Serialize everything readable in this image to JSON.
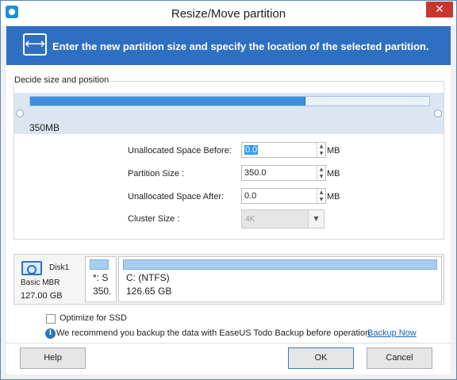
{
  "window": {
    "title": "Resize/Move partition",
    "close_glyph": "✕"
  },
  "banner": {
    "icon": "resize-arrows-icon",
    "text": "Enter the new partition size and specify the location of the selected partition."
  },
  "size_group": {
    "title": "Decide size and position",
    "size_label": "350MB",
    "fill_percent": 69
  },
  "fields": {
    "before": {
      "label": "Unallocated Space Before:",
      "value": "0.0",
      "unit": "MB"
    },
    "size": {
      "label": "Partition Size :",
      "value": "350.0",
      "unit": "MB"
    },
    "after": {
      "label": "Unallocated Space After:",
      "value": "0.0",
      "unit": "MB"
    },
    "cluster": {
      "label": "Cluster Size :",
      "value": "4K"
    }
  },
  "disk_map": {
    "disk_name": "Disk1",
    "disk_type": "Basic MBR",
    "disk_size": "127.00 GB",
    "partitions": [
      {
        "name": "*: S",
        "size": "350."
      },
      {
        "name": "C: (NTFS)",
        "size": "126.65 GB"
      }
    ]
  },
  "options": {
    "optimize_ssd": "Optimize for SSD",
    "recommend": "We recommend you backup the data with EaseUS Todo Backup before operation.",
    "backup_link": "Backup Now"
  },
  "buttons": {
    "help": "Help",
    "ok": "OK",
    "cancel": "Cancel"
  },
  "colors": {
    "banner": "#2f6fc2",
    "accent": "#3d8fd9",
    "close": "#c7372f"
  }
}
